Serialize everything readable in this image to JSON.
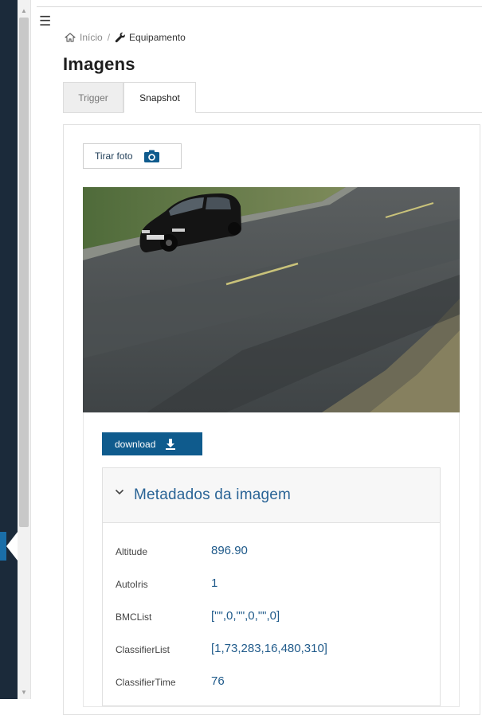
{
  "breadcrumb": {
    "home": "Início",
    "separator": "/",
    "current": "Equipamento"
  },
  "page": {
    "title": "Imagens"
  },
  "tabs": [
    {
      "label": "Trigger",
      "active": false
    },
    {
      "label": "Snapshot",
      "active": true
    }
  ],
  "actions": {
    "take_photo": "Tirar foto",
    "download": "download"
  },
  "metadata": {
    "title": "Metadados da imagem",
    "expanded": true,
    "rows": [
      {
        "key": "Altitude",
        "value": "896.90"
      },
      {
        "key": "AutoIris",
        "value": "1"
      },
      {
        "key": "BMCList",
        "value": "[\"\",0,\"\",0,\"\",0]"
      },
      {
        "key": "ClassifierList",
        "value": "[1,73,283,16,480,310]"
      },
      {
        "key": "ClassifierTime",
        "value": "76"
      }
    ]
  },
  "icons": {
    "menu": "list-icon",
    "home": "home-icon",
    "equipment": "wrench-icon",
    "camera": "camera-icon",
    "download": "download-icon",
    "accordion": "chevron-down-icon",
    "sidebar_toggle": "chevron-left-icon"
  },
  "colors": {
    "accent": "#0f5b8d",
    "link": "#2a6496",
    "rail": "#1b2a3a"
  }
}
